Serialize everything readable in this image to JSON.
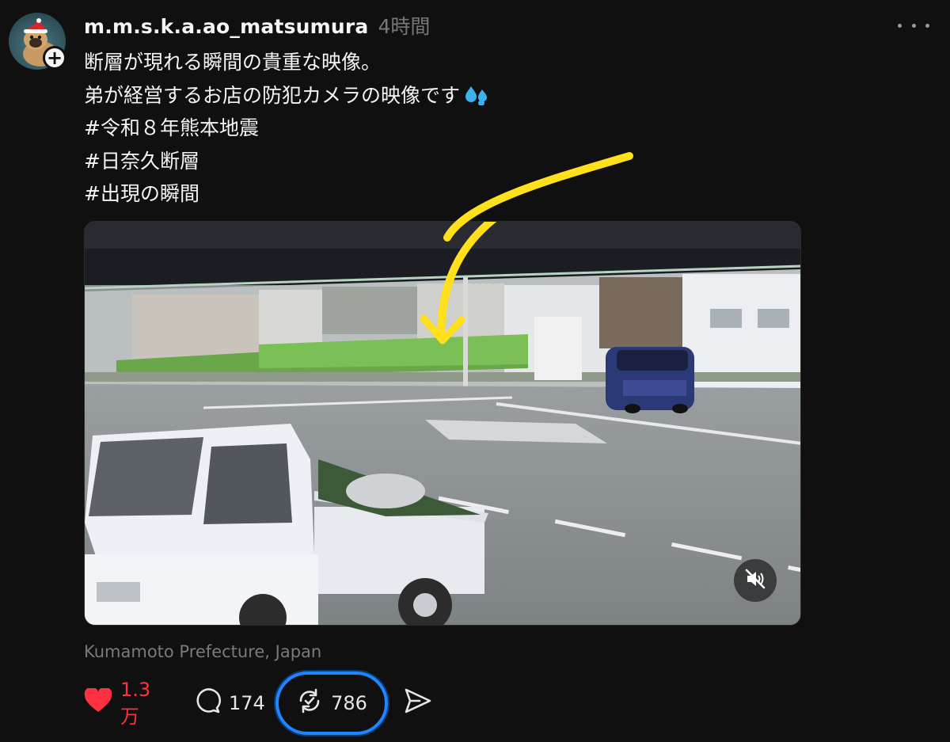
{
  "post": {
    "username": "m.m.s.k.a.ao_matsumura",
    "time_ago": "4時間",
    "caption_lines": [
      "断層が現れる瞬間の貴重な映像。",
      "弟が経営するお店の防犯カメラの映像です"
    ],
    "hashtags": [
      "#令和８年熊本地震",
      "#日奈久断層",
      "#出現の瞬間"
    ],
    "location": "Kumamoto Prefecture, Japan"
  },
  "actions": {
    "likes": "1.3万",
    "comments": "174",
    "reposts": "786"
  },
  "icons": {
    "follow": "plus-icon",
    "more": "more-dots-icon",
    "mute": "muted-speaker-icon",
    "like": "heart-icon",
    "comment": "comment-bubble-icon",
    "repost": "repost-icon",
    "share": "send-icon",
    "emoji": "sweat-droplets-emoji"
  },
  "colors": {
    "background": "#101010",
    "text": "#f3f5f7",
    "muted": "#777777",
    "like_red": "#ff3040",
    "highlight_blue": "#1e86ff",
    "arrow_yellow": "#ffe01a"
  },
  "video": {
    "muted": true
  }
}
